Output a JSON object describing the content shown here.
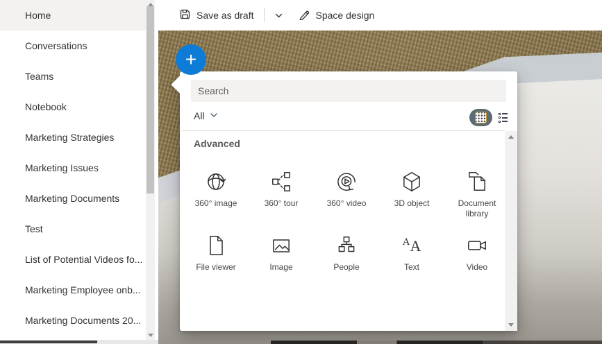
{
  "toolbar": {
    "save_button": "Save as draft",
    "design_button": "Space design"
  },
  "sidebar": {
    "items": [
      "Home",
      "Conversations",
      "Teams",
      "Notebook",
      "Marketing Strategies",
      "Marketing Issues",
      "Marketing Documents",
      "Test",
      "List of Potential Videos fo...",
      "Marketing Employee onb...",
      "Marketing Documents 20..."
    ]
  },
  "plus_button": {
    "glyph": "+"
  },
  "add_panel": {
    "search_placeholder": "Search",
    "filter_label": "All",
    "section_title": "Advanced",
    "text_glyph_small": "A",
    "text_glyph_large": "A",
    "tiles": [
      {
        "label": "360° image",
        "icon": "globe-360-icon"
      },
      {
        "label": "360° tour",
        "icon": "tour-360-icon"
      },
      {
        "label": "360° video",
        "icon": "video-360-icon"
      },
      {
        "label": "3D object",
        "icon": "cube-3d-icon"
      },
      {
        "label": "Document library",
        "icon": "document-library-icon"
      },
      {
        "label": "File viewer",
        "icon": "file-page-icon"
      },
      {
        "label": "Image",
        "icon": "picture-icon"
      },
      {
        "label": "People",
        "icon": "org-chart-icon"
      },
      {
        "label": "Text",
        "icon": "text-aa-icon"
      },
      {
        "label": "Video",
        "icon": "video-camera-icon"
      }
    ]
  },
  "colors": {
    "accent_blue": "#0d7cd6",
    "search_bg": "#f3f2f1",
    "text_primary": "#323130",
    "section_title_gray": "#5b5855",
    "toggle_selected_bg": "#5b6a73",
    "toggle_focus_ring": "#cf9f35"
  }
}
